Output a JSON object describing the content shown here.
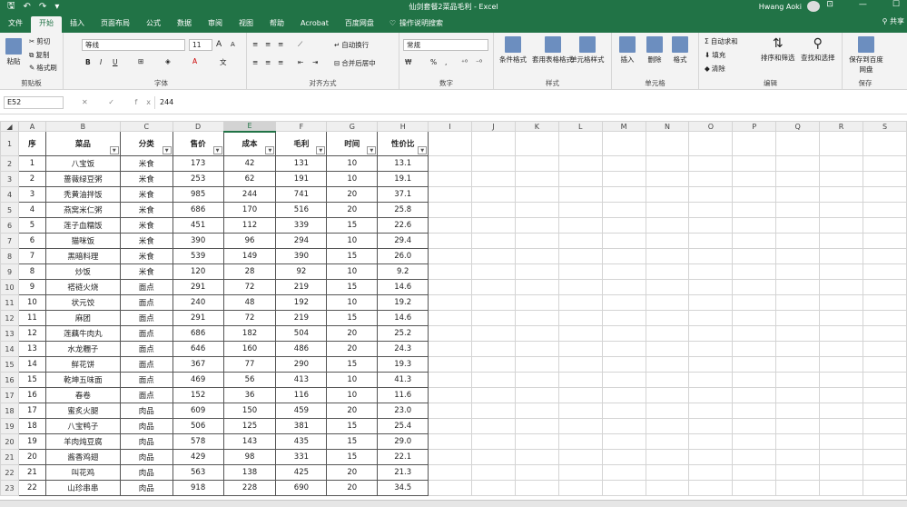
{
  "app": {
    "title": "仙剑套餐2菜品毛利 - Excel",
    "user": "Hwang Aoki"
  },
  "tabs": [
    "文件",
    "开始",
    "插入",
    "页面布局",
    "公式",
    "数据",
    "审阅",
    "视图",
    "帮助",
    "Acrobat",
    "百度网盘"
  ],
  "tell_me": "操作说明搜索",
  "share": "共享",
  "ribbon": {
    "clipboard": {
      "label": "剪贴板",
      "paste": "粘贴",
      "cut": "剪切",
      "copy": "复制",
      "painter": "格式刷"
    },
    "font": {
      "label": "字体",
      "name": "等线",
      "size": "11",
      "bold": "B",
      "italic": "I",
      "underline": "U",
      "grow": "A",
      "shrink": "A"
    },
    "alignment": {
      "label": "对齐方式",
      "wrap": "自动换行",
      "merge": "合并后居中"
    },
    "number": {
      "label": "数字",
      "format": "常规"
    },
    "styles": {
      "label": "样式",
      "conditional": "条件格式",
      "table": "套用表格格式",
      "cell": "单元格样式"
    },
    "cells": {
      "label": "单元格",
      "insert": "插入",
      "delete": "删除",
      "format": "格式"
    },
    "editing": {
      "label": "编辑",
      "autosum": "自动求和",
      "fill": "填充",
      "clear": "清除",
      "sort": "排序和筛选",
      "find": "查找和选择"
    },
    "save": {
      "label": "保存",
      "button": "保存到百度网盘"
    }
  },
  "formula": {
    "name_box": "E52",
    "fx": "✕ ✓ fx",
    "value": "244"
  },
  "columns": [
    "A",
    "B",
    "C",
    "D",
    "E",
    "F",
    "G",
    "H",
    "I",
    "J",
    "K",
    "L",
    "M",
    "N",
    "O",
    "P",
    "Q",
    "R",
    "S"
  ],
  "headers": [
    "序",
    "菜品",
    "分类",
    "售价",
    "成本",
    "毛利",
    "时间",
    "性价比"
  ],
  "rows": [
    [
      "1",
      "八宝饭",
      "米食",
      "173",
      "42",
      "131",
      "10",
      "13.1"
    ],
    [
      "2",
      "蔷薇绿豆粥",
      "米食",
      "253",
      "62",
      "191",
      "10",
      "19.1"
    ],
    [
      "3",
      "秃黄油拌饭",
      "米食",
      "985",
      "244",
      "741",
      "20",
      "37.1"
    ],
    [
      "4",
      "燕窝米仁粥",
      "米食",
      "686",
      "170",
      "516",
      "20",
      "25.8"
    ],
    [
      "5",
      "莲子血糯饭",
      "米食",
      "451",
      "112",
      "339",
      "15",
      "22.6"
    ],
    [
      "6",
      "猫咪饭",
      "米食",
      "390",
      "96",
      "294",
      "10",
      "29.4"
    ],
    [
      "7",
      "黑暗料理",
      "米食",
      "539",
      "149",
      "390",
      "15",
      "26.0"
    ],
    [
      "8",
      "炒饭",
      "米食",
      "120",
      "28",
      "92",
      "10",
      "9.2"
    ],
    [
      "9",
      "褡裢火烧",
      "面点",
      "291",
      "72",
      "219",
      "15",
      "14.6"
    ],
    [
      "10",
      "状元饺",
      "面点",
      "240",
      "48",
      "192",
      "10",
      "19.2"
    ],
    [
      "11",
      "麻团",
      "面点",
      "291",
      "72",
      "219",
      "15",
      "14.6"
    ],
    [
      "12",
      "莲藕牛肉丸",
      "面点",
      "686",
      "182",
      "504",
      "20",
      "25.2"
    ],
    [
      "13",
      "水龙糰子",
      "面点",
      "646",
      "160",
      "486",
      "20",
      "24.3"
    ],
    [
      "14",
      "鲜花饼",
      "面点",
      "367",
      "77",
      "290",
      "15",
      "19.3"
    ],
    [
      "15",
      "乾坤五味面",
      "面点",
      "469",
      "56",
      "413",
      "10",
      "41.3"
    ],
    [
      "16",
      "春卷",
      "面点",
      "152",
      "36",
      "116",
      "10",
      "11.6"
    ],
    [
      "17",
      "蜜炙火腿",
      "肉品",
      "609",
      "150",
      "459",
      "20",
      "23.0"
    ],
    [
      "18",
      "八宝鸭子",
      "肉品",
      "506",
      "125",
      "381",
      "15",
      "25.4"
    ],
    [
      "19",
      "羊肉炖豆腐",
      "肉品",
      "578",
      "143",
      "435",
      "15",
      "29.0"
    ],
    [
      "20",
      "酱香鸡翅",
      "肉品",
      "429",
      "98",
      "331",
      "15",
      "22.1"
    ],
    [
      "21",
      "叫花鸡",
      "肉品",
      "563",
      "138",
      "425",
      "20",
      "21.3"
    ],
    [
      "22",
      "山珍串串",
      "肉品",
      "918",
      "228",
      "690",
      "20",
      "34.5"
    ]
  ]
}
